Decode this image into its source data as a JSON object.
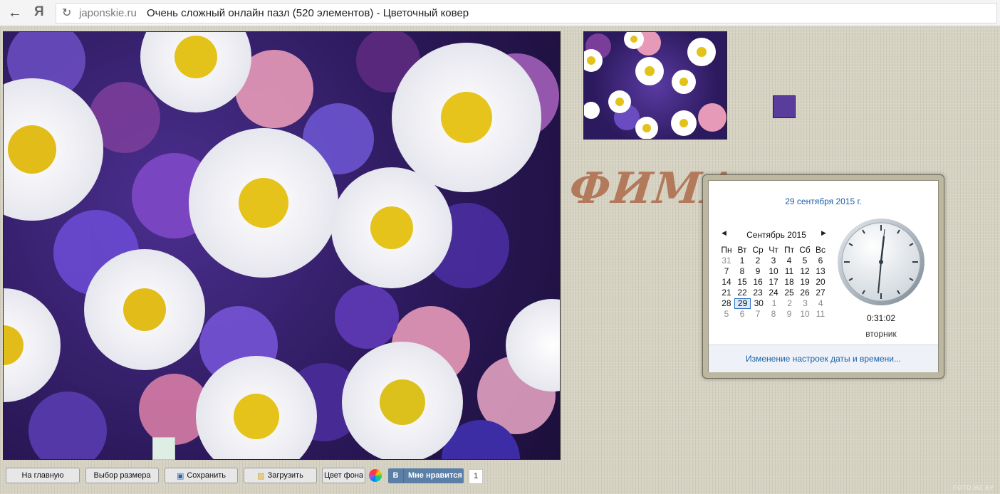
{
  "browser": {
    "brand": "Я",
    "domain": "japonskie.ru",
    "title": "Очень сложный онлайн пазл (520 элементов) - Цветочный ковер"
  },
  "overlay_text": "ФИМА",
  "calendar": {
    "date_header": "29 сентября 2015 г.",
    "month_label": "Сентябрь 2015",
    "weekdays": [
      "Пн",
      "Вт",
      "Ср",
      "Чт",
      "Пт",
      "Сб",
      "Вс"
    ],
    "weeks": [
      [
        "31",
        "1",
        "2",
        "3",
        "4",
        "5",
        "6"
      ],
      [
        "7",
        "8",
        "9",
        "10",
        "11",
        "12",
        "13"
      ],
      [
        "14",
        "15",
        "16",
        "17",
        "18",
        "19",
        "20"
      ],
      [
        "21",
        "22",
        "23",
        "24",
        "25",
        "26",
        "27"
      ],
      [
        "28",
        "29",
        "30",
        "1",
        "2",
        "3",
        "4"
      ],
      [
        "5",
        "6",
        "7",
        "8",
        "9",
        "10",
        "11"
      ]
    ],
    "time": "0:31:02",
    "weekday": "вторник",
    "settings_link": "Изменение настроек даты и времени..."
  },
  "toolbar": {
    "home": "На главную",
    "size": "Выбор размера",
    "save": "Сохранить",
    "load": "Загрузить",
    "bg_color": "Цвет фона",
    "vk_letter": "В",
    "like": "Мне нравится",
    "like_count": "1"
  },
  "watermark": "FOTO.HZ.BY"
}
